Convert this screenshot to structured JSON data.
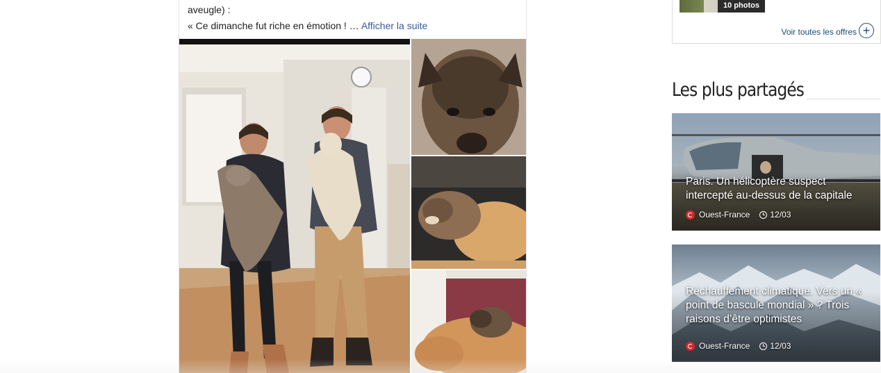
{
  "post": {
    "text_line_1": "aveugle) :",
    "text_line_2": "« Ce dimanche fut riche en émotion ! …",
    "see_more": "Afficher la suite",
    "photos": [
      {
        "icon": "photo-couple-holding-puppies"
      },
      {
        "icon": "photo-puppy-closeup"
      },
      {
        "icon": "photo-puppies-sleeping"
      },
      {
        "icon": "photo-puppy-on-dog"
      }
    ]
  },
  "offers": {
    "photo_count": "10 photos",
    "link_label": "Voir toutes les offres",
    "plus_icon": "+"
  },
  "most_shared": {
    "title": "Les plus partagés",
    "articles": [
      {
        "title": "Paris. Un hélicoptère suspect intercepté au-dessus de la capitale",
        "source": "Ouest-France",
        "date": "12/03",
        "image_icon": "helicopter-image"
      },
      {
        "title": "Réchauffement climatique. Vers un « point de bascule mondial » ? Trois raisons d’être optimistes",
        "source": "Ouest-France",
        "date": "12/03",
        "image_icon": "mountains-image"
      }
    ]
  },
  "colors": {
    "link": "#385898",
    "offers_link": "#1a4a7a",
    "source_red": "#d8262e"
  }
}
